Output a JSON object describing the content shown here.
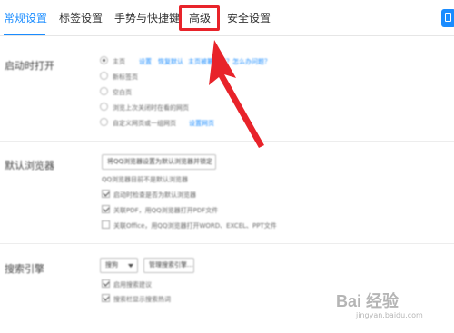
{
  "tabs": [
    {
      "label": "常规设置",
      "active": true
    },
    {
      "label": "标签设置",
      "active": false
    },
    {
      "label": "手势与快捷键",
      "active": false
    },
    {
      "label": "高级",
      "active": false
    },
    {
      "label": "安全设置",
      "active": false
    }
  ],
  "startup": {
    "label": "启动时打开",
    "options": [
      "主页",
      "新标签页",
      "空白页",
      "浏览上次关闭时在看的网页",
      "自定义网页或一组网页"
    ],
    "set_link": "设置",
    "restore_link": "恢复默认",
    "homepage_link": "主页被篡改了？怎么办问题？",
    "custom_link": "设置网页"
  },
  "default_browser": {
    "label": "默认浏览器",
    "button": "将QQ浏览器设置为默认浏览器并锁定",
    "status": "QQ浏览器目前不是默认浏览器",
    "checks": [
      {
        "label": "启动时检查是否为默认浏览器",
        "checked": true
      },
      {
        "label": "关联PDF，用QQ浏览器打开PDF文件",
        "checked": true
      },
      {
        "label": "关联Office，用QQ浏览器打开WORD、EXCEL、PPT文件",
        "checked": false
      }
    ]
  },
  "search": {
    "label": "搜索引擎",
    "engine": "搜狗",
    "manage_button": "管理搜索引擎...",
    "checks": [
      {
        "label": "启用搜索建议",
        "checked": true
      },
      {
        "label": "搜索栏显示搜索热词",
        "checked": true
      }
    ]
  },
  "watermark": {
    "text": "Bai 经验",
    "sub": "jingyan.baidu.com"
  },
  "colors": {
    "accent": "#1a8cff",
    "annotation": "#e8232a"
  },
  "icons": [
    "app-menu-icon",
    "annotation-arrow-icon"
  ]
}
